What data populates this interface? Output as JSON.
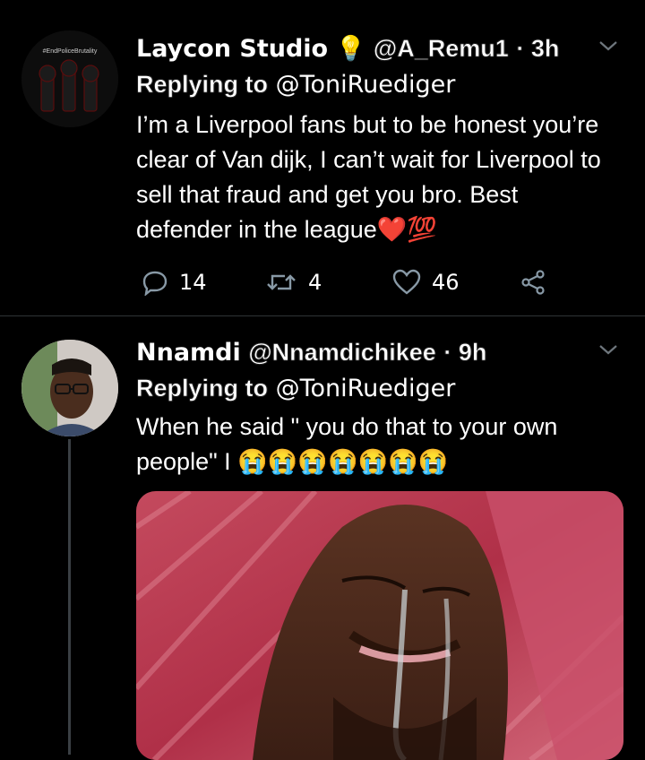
{
  "tweet1": {
    "avatar_text": "#EndPoliceBrutality",
    "name": "Laycon Studio",
    "name_emoji": "💡",
    "handle": "@A_Remu1",
    "time": "· 3h",
    "replying_prefix": "Replying to",
    "replying_to": "@ToniRuediger",
    "text": "I’m a Liverpool fans but to be honest you’re clear of Van dijk, I can’t wait for Liverpool to sell that fraud and get you bro. Best defender in the league❤️💯",
    "replies": "14",
    "retweets": "4",
    "likes": "46"
  },
  "tweet2": {
    "name": "Nnamdi",
    "handle": "@Nnamdichikee",
    "time": "· 9h",
    "replying_prefix": "Replying to",
    "replying_to": "@ToniRuediger",
    "text": "When he said \" you do that to your own people\" I 😭😭😭😭😭😭😭"
  },
  "colors": {
    "background": "#000000",
    "text": "#ffffff",
    "divider": "#2f3336",
    "icon": "#8899a6"
  }
}
